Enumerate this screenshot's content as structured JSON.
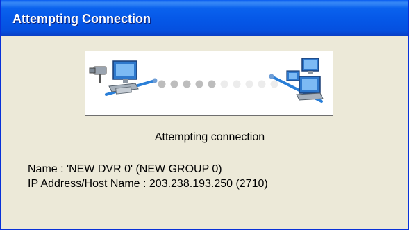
{
  "window": {
    "title": "Attempting Connection"
  },
  "status": {
    "text": "Attempting connection"
  },
  "details": {
    "name_line": "Name : 'NEW DVR 0' (NEW GROUP 0)",
    "ip_line": "IP Address/Host Name : 203.238.193.250 (2710)"
  },
  "progress": {
    "dots_total": 10,
    "dots_active": 5
  },
  "icons": [
    "dvr-computer-icon",
    "network-computers-icon"
  ],
  "colors": {
    "title_bar": "#0555e4",
    "dialog_bg": "#ece9d8",
    "dot_active": "#bdbdbd",
    "dot_inactive": "#ececec"
  }
}
